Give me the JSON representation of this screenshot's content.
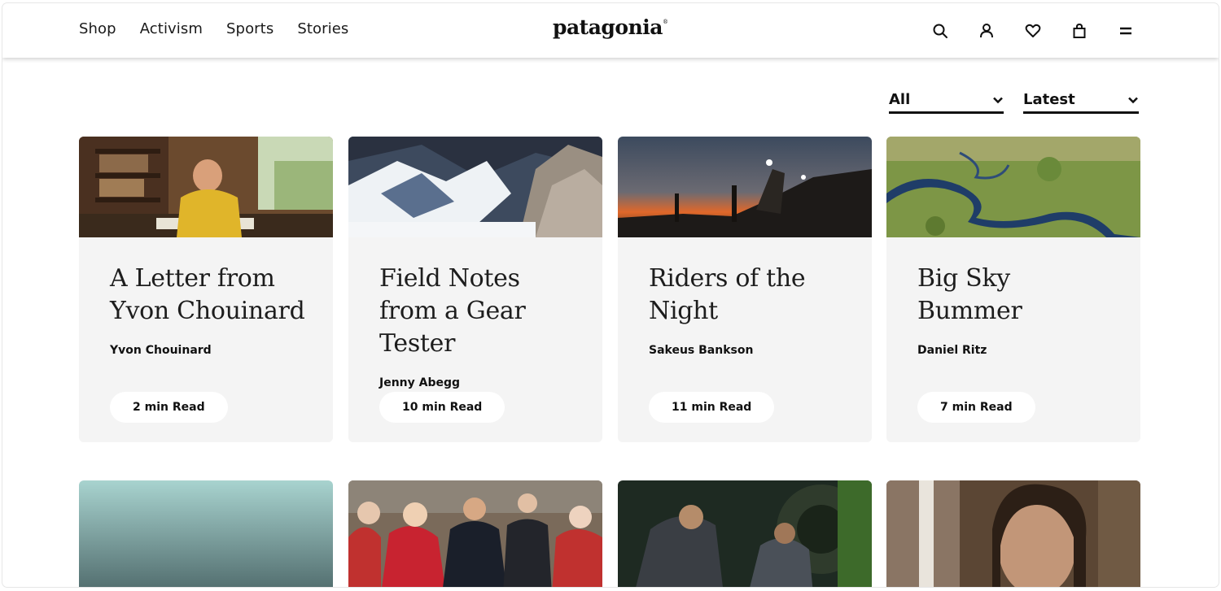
{
  "header": {
    "nav": [
      "Shop",
      "Activism",
      "Sports",
      "Stories"
    ],
    "logo": "patagonia",
    "logo_mark": "®",
    "icons": [
      "search-icon",
      "account-icon",
      "wishlist-icon",
      "bag-icon",
      "menu-icon"
    ]
  },
  "filters": {
    "category": "All",
    "sort": "Latest"
  },
  "stories": [
    {
      "title": "A Letter from Yvon Chouinard",
      "author": "Yvon Chouinard",
      "read": "2 min Read"
    },
    {
      "title": "Field Notes from a Gear Tester",
      "author": "Jenny Abegg",
      "read": "10 min Read"
    },
    {
      "title": "Riders of the Night",
      "author": "Sakeus Bankson",
      "read": "11 min Read"
    },
    {
      "title": "Big Sky Bummer",
      "author": "Daniel Ritz",
      "read": "7 min Read"
    }
  ],
  "colors": {
    "card_bg": "#f4f4f4",
    "text": "#111111",
    "pill_bg": "#ffffff"
  }
}
